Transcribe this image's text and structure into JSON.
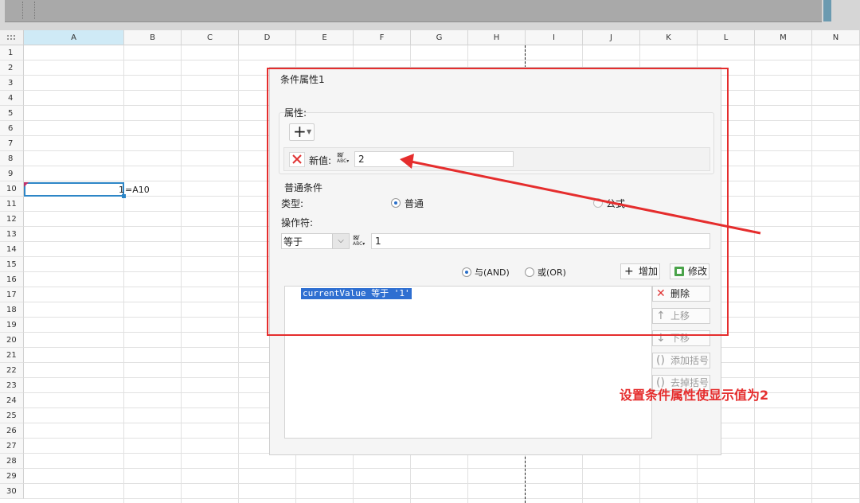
{
  "spreadsheet": {
    "columns": [
      "A",
      "B",
      "C",
      "D",
      "E",
      "F",
      "G",
      "H",
      "I",
      "J",
      "K",
      "L",
      "M",
      "N"
    ],
    "rows": [
      "1",
      "2",
      "3",
      "4",
      "5",
      "6",
      "7",
      "8",
      "9",
      "10",
      "11",
      "12",
      "13",
      "14",
      "15",
      "16",
      "17",
      "18",
      "19",
      "20",
      "21",
      "22",
      "23",
      "24",
      "25",
      "26",
      "27",
      "28",
      "29",
      "30"
    ],
    "selected_column": "A",
    "selected_cell_value": "1",
    "adjacent_formula": "=A10"
  },
  "dialog": {
    "title": "条件属性1",
    "attributes_group_label": "属性:",
    "new_value_label": "新值:",
    "new_value": "2",
    "condition_group_label": "普通条件",
    "type_label": "类型:",
    "type_normal": "普通",
    "type_formula": "公式",
    "operator_label": "操作符:",
    "operator_value": "等于",
    "operand_value": "1",
    "logic_and": "与(AND)",
    "logic_or": "或(OR)",
    "add_button": "增加",
    "modify_button": "修改",
    "condition_item": "currentValue 等于 '1'",
    "delete_button": "删除",
    "move_up_button": "上移",
    "move_down_button": "下移",
    "add_bracket_button": "添加括号",
    "remove_bracket_button": "去掉括号"
  },
  "annotation": {
    "text": "设置条件属性使显示值为2",
    "color": "#e52d2d"
  },
  "colors": {
    "accent": "#2d86c7",
    "selection": "#2f6fd1",
    "column_highlight": "#cfeaf6"
  },
  "icons": [
    "plus-icon",
    "delete-x-icon",
    "abc-format-icon",
    "chevron-down-icon",
    "edit-icon",
    "arrow-up-icon",
    "arrow-down-icon",
    "bracket-icon"
  ]
}
